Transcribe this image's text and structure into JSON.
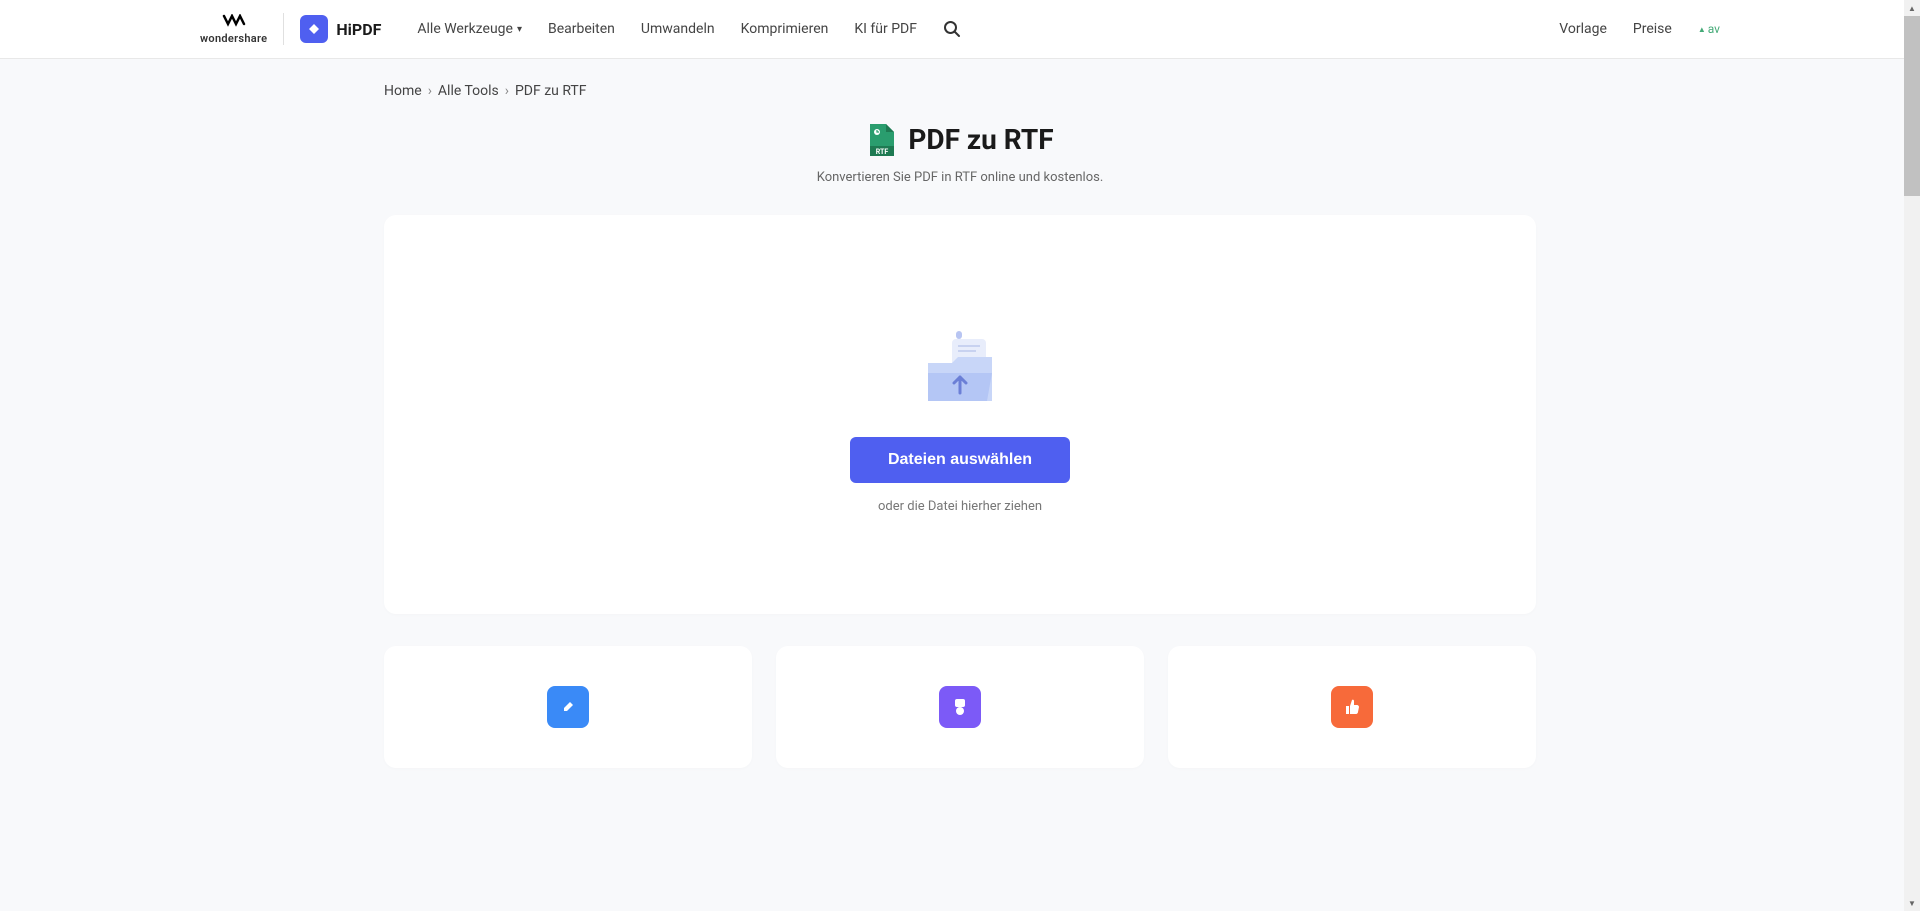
{
  "header": {
    "wondershare_label": "wondershare",
    "hipdf_label": "HiPDF",
    "nav": {
      "all_tools": "Alle Werkzeuge",
      "edit": "Bearbeiten",
      "convert": "Umwandeln",
      "compress": "Komprimieren",
      "ai_pdf": "KI für PDF"
    },
    "right": {
      "template": "Vorlage",
      "pricing": "Preise",
      "avatar_alt": "av"
    }
  },
  "breadcrumb": {
    "home": "Home",
    "all_tools": "Alle Tools",
    "current": "PDF zu RTF"
  },
  "page": {
    "title": "PDF zu RTF",
    "subtitle": "Konvertieren Sie PDF in RTF online und kostenlos."
  },
  "upload": {
    "button": "Dateien auswählen",
    "drop_text": "oder die Datei hierher ziehen"
  },
  "features": {
    "items": [
      {
        "icon": "edit"
      },
      {
        "icon": "badge"
      },
      {
        "icon": "thumbsup"
      }
    ]
  }
}
